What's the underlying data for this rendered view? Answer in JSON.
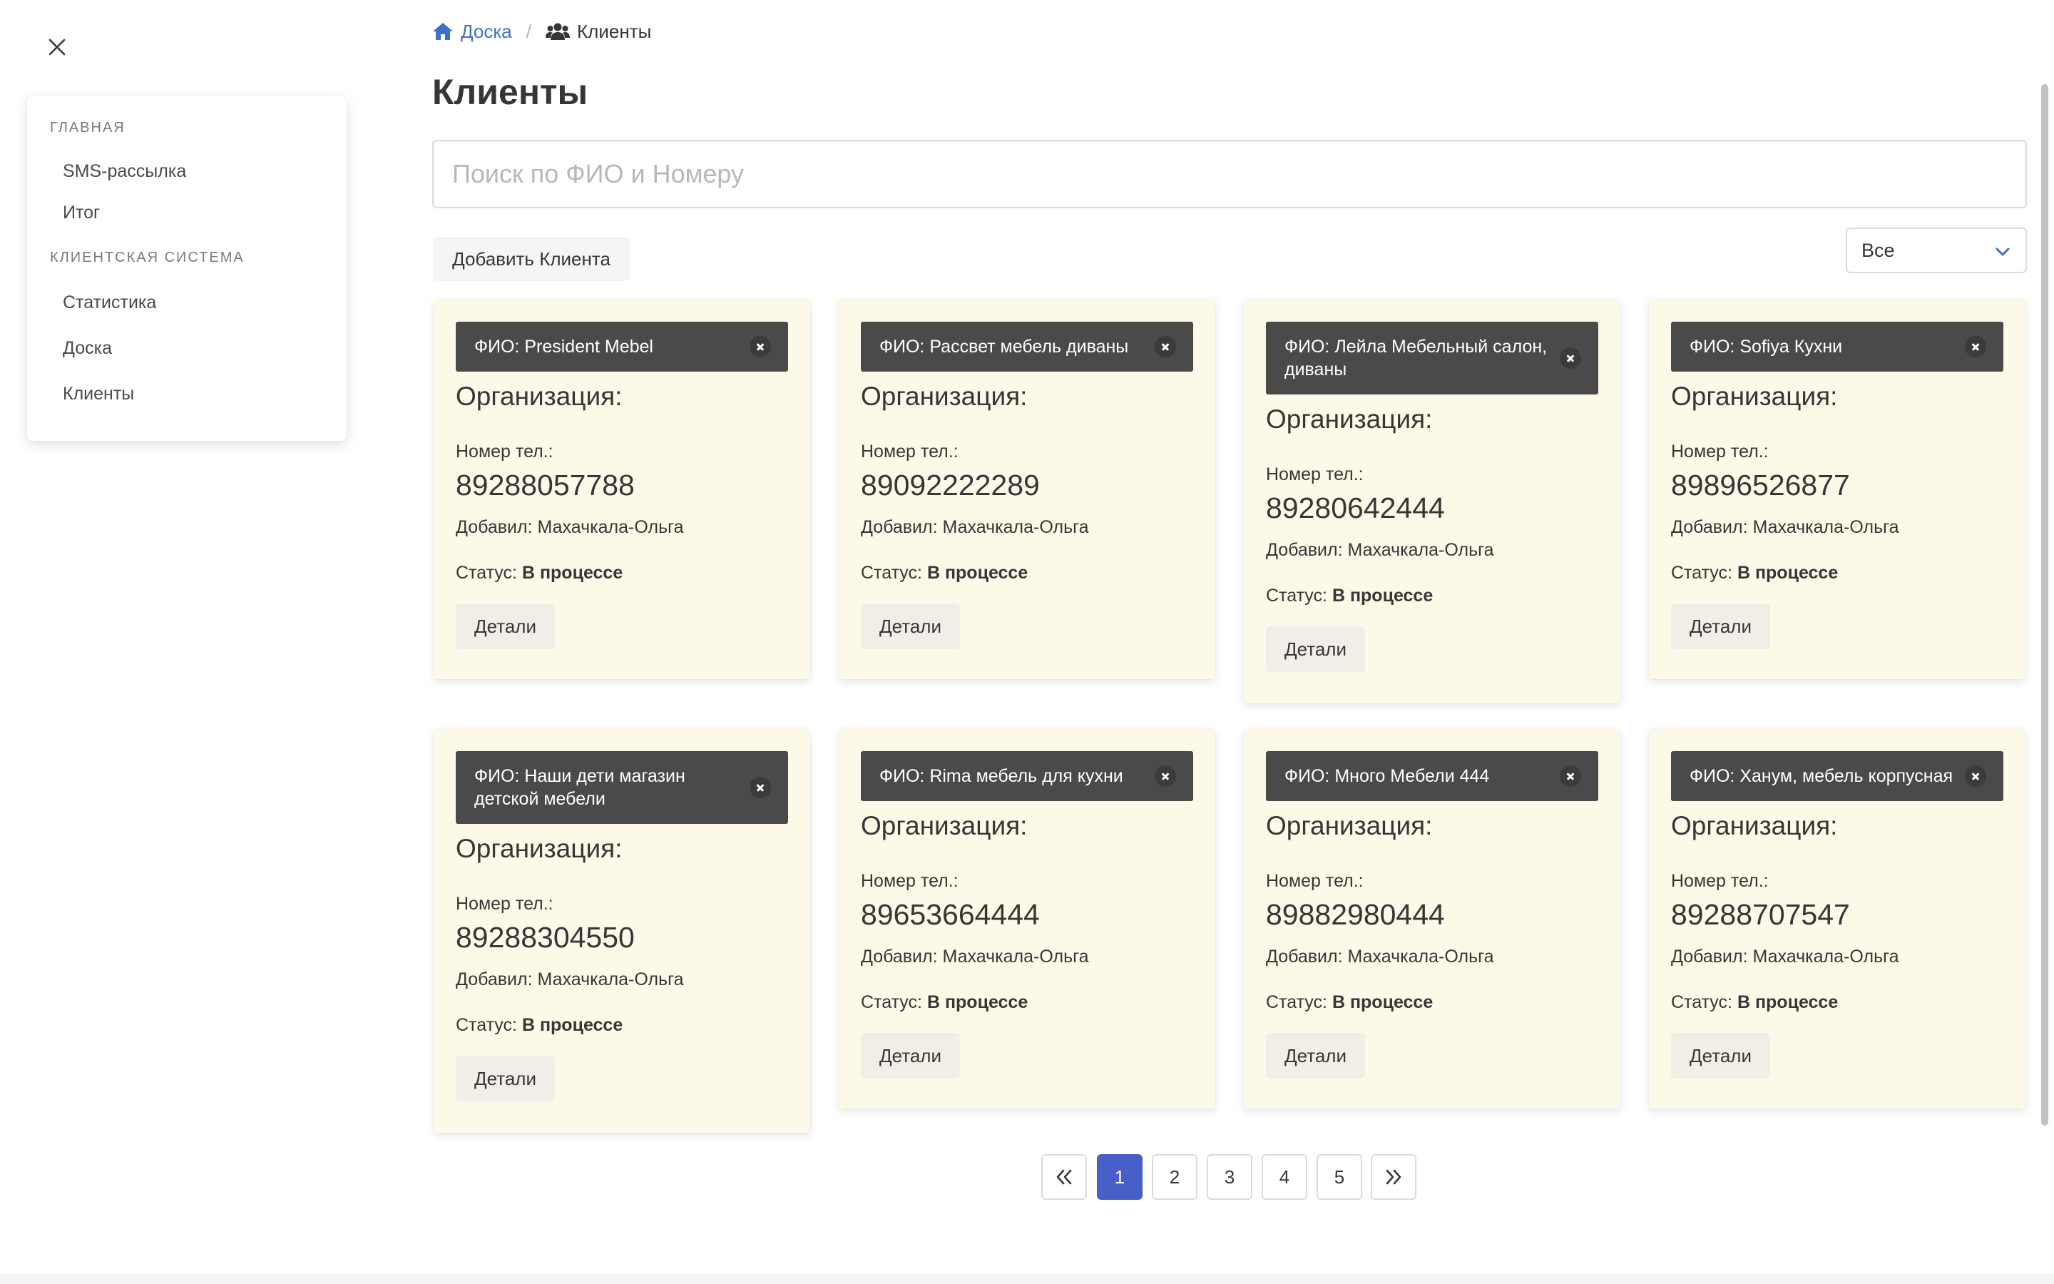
{
  "sidebar": {
    "close_icon": "close-icon",
    "sections": [
      {
        "label": "ГЛАВНАЯ",
        "items": [
          "SMS-рассылка",
          "Итог"
        ]
      },
      {
        "label": "КЛИЕНТСКАЯ СИСТЕМА",
        "items": [
          "Статистика",
          "Доска",
          "Клиенты"
        ]
      }
    ]
  },
  "breadcrumb": {
    "home": "Доска",
    "current": "Клиенты",
    "home_icon": "home-icon",
    "current_icon": "users-icon",
    "link_color": "#3e70c9"
  },
  "page": {
    "title": "Клиенты"
  },
  "search": {
    "placeholder": "Поиск по ФИО и Номеру",
    "value": ""
  },
  "toolbar": {
    "add_client": "Добавить Клиента",
    "filter_value": "Все",
    "filter_icon": "chevron-down-icon",
    "accent": "#3e70c9"
  },
  "labels": {
    "fio_prefix": "ФИО:",
    "org": "Организация:",
    "phone": "Номер тел.:",
    "added_by": "Добавил:",
    "status": "Статус:",
    "details": "Детали"
  },
  "clients": [
    {
      "fio": "President Mebel",
      "phone": "89288057788",
      "added_by": "Махачкала-Ольга",
      "status": "В процессе"
    },
    {
      "fio": "Рассвет мебель диваны",
      "phone": "89092222289",
      "added_by": "Махачкала-Ольга",
      "status": "В процессе"
    },
    {
      "fio": "Лейла Мебельный салон, диваны",
      "phone": "89280642444",
      "added_by": "Махачкала-Ольга",
      "status": "В процессе"
    },
    {
      "fio": "Sofiya Кухни",
      "phone": "89896526877",
      "added_by": "Махачкала-Ольга",
      "status": "В процессе"
    },
    {
      "fio": "Наши дети магазин детской мебели",
      "phone": "89288304550",
      "added_by": "Махачкала-Ольга",
      "status": "В процессе"
    },
    {
      "fio": "Rima мебель для кухни",
      "phone": "89653664444",
      "added_by": "Махачкала-Ольга",
      "status": "В процессе"
    },
    {
      "fio": "Много Мебели 444",
      "phone": "89882980444",
      "added_by": "Махачкала-Ольга",
      "status": "В процессе"
    },
    {
      "fio": "Ханум, мебель корпусная",
      "phone": "89288707547",
      "added_by": "Махачкала-Ольга",
      "status": "В процессе"
    }
  ],
  "pagination": {
    "first_icon": "chevrons-left-icon",
    "last_icon": "chevrons-right-icon",
    "pages": [
      "1",
      "2",
      "3",
      "4",
      "5"
    ],
    "current": "1",
    "active_color": "#485fc7"
  },
  "colors": {
    "card_bg": "#fdf9e9",
    "tag_bg": "#4a4a4a",
    "text": "#363636"
  }
}
